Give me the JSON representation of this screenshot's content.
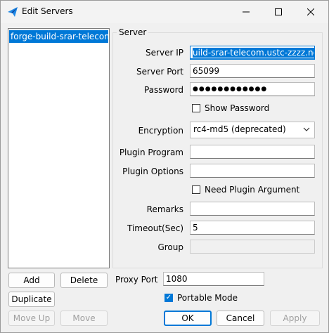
{
  "window": {
    "title": "Edit Servers"
  },
  "servers": [
    {
      "label": "forge-build-srar-telecom"
    }
  ],
  "group": {
    "title": "Server"
  },
  "fields": {
    "server_ip": {
      "label": "Server IP",
      "value": "uild-srar-telecom.ustc-zzzz.net"
    },
    "server_port": {
      "label": "Server Port",
      "value": "65099"
    },
    "password": {
      "label": "Password",
      "value": "●●●●●●●●●●●●"
    },
    "show_password": {
      "label": "Show Password",
      "checked": false
    },
    "encryption": {
      "label": "Encryption",
      "value": "rc4-md5 (deprecated)"
    },
    "plugin_program": {
      "label": "Plugin Program",
      "value": ""
    },
    "plugin_options": {
      "label": "Plugin Options",
      "value": ""
    },
    "need_plugin_argument": {
      "label": "Need Plugin Argument",
      "checked": false
    },
    "remarks": {
      "label": "Remarks",
      "value": ""
    },
    "timeout": {
      "label": "Timeout(Sec)",
      "value": "5"
    },
    "group": {
      "label": "Group",
      "value": ""
    }
  },
  "proxy_port": {
    "label": "Proxy Port",
    "value": "1080"
  },
  "portable_mode": {
    "label": "Portable Mode",
    "checked": true
  },
  "buttons": {
    "add": "Add",
    "delete": "Delete",
    "duplicate": "Duplicate",
    "move_up": "Move Up",
    "move": "Move",
    "ok": "OK",
    "cancel": "Cancel",
    "apply": "Apply"
  },
  "colors": {
    "accent": "#0078d7"
  }
}
